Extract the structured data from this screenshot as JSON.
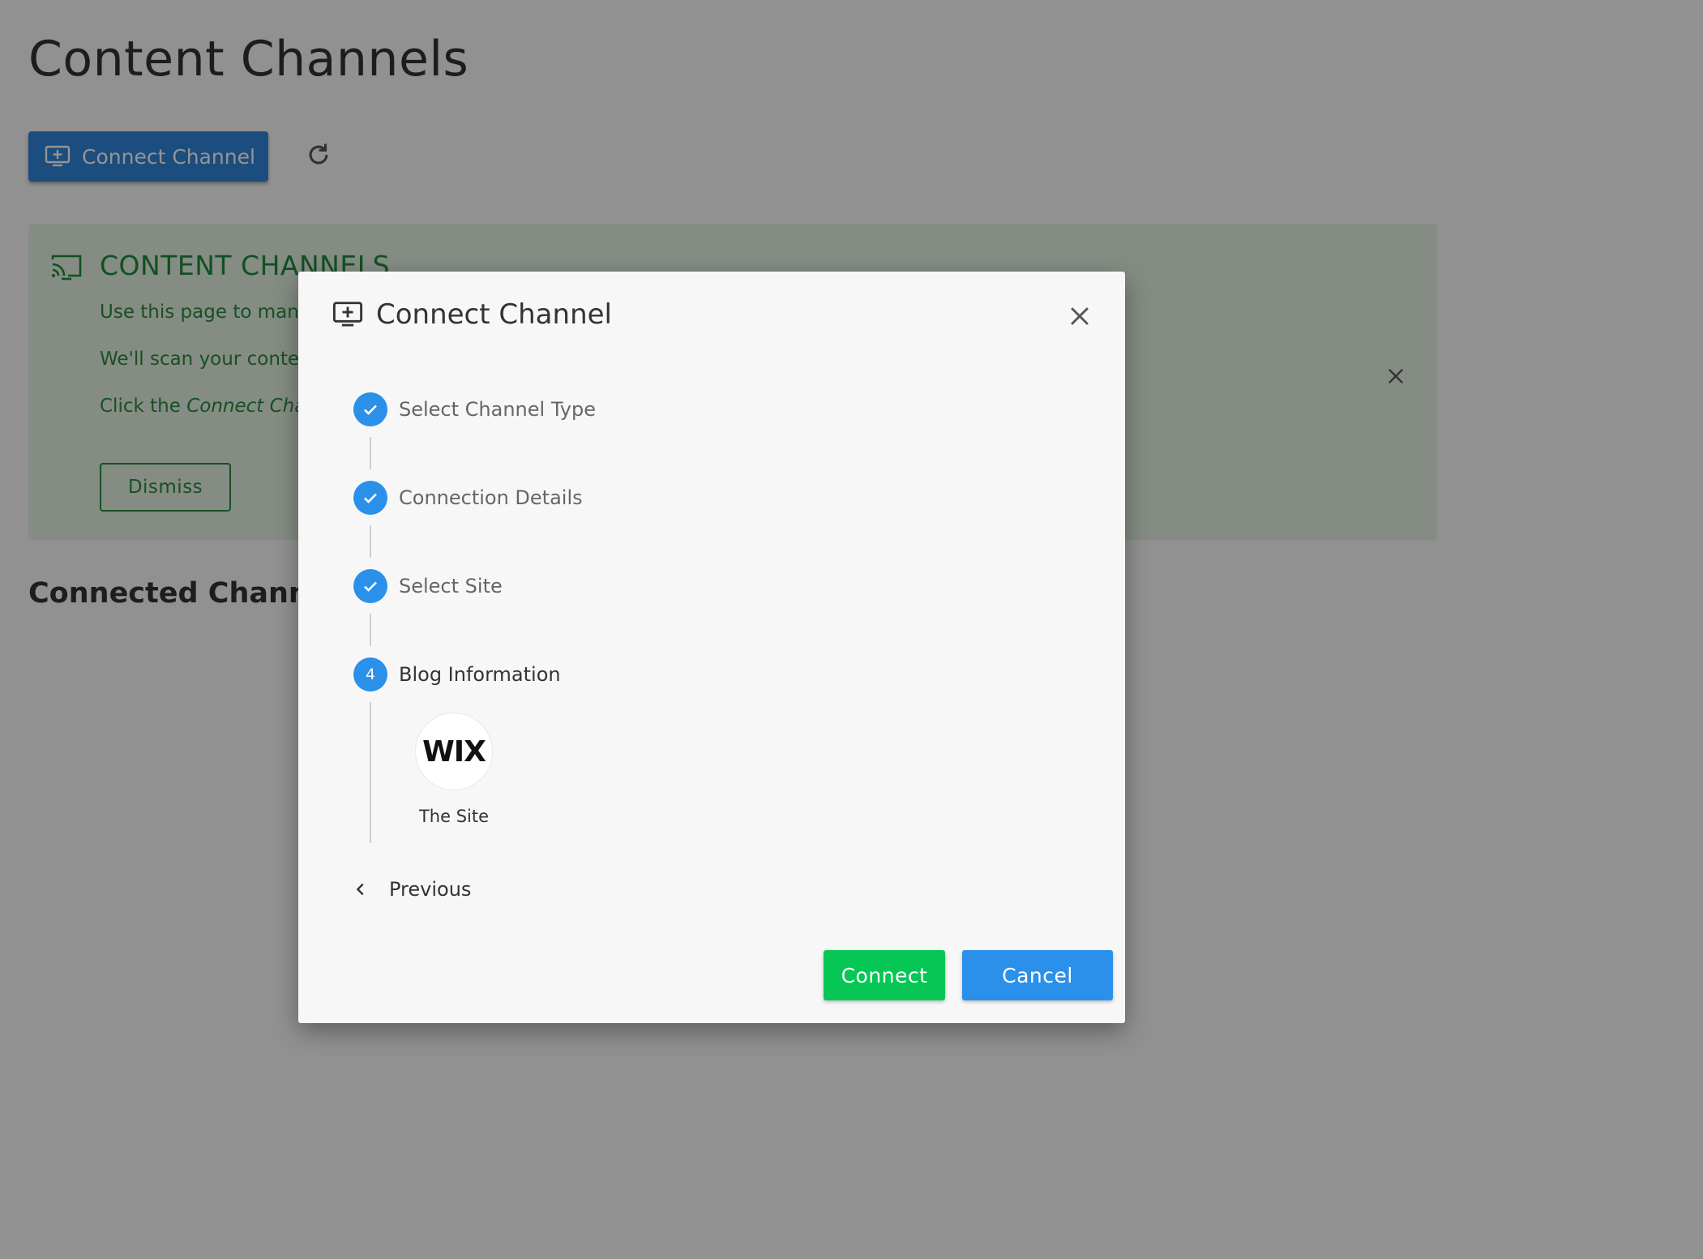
{
  "page": {
    "title": "Content Channels",
    "connect_button_label": "Connect Channel",
    "section_title": "Connected Channels"
  },
  "info_panel": {
    "heading": "CONTENT CHANNELS",
    "line1": "Use this page to mana",
    "line2": "We'll scan your conten",
    "line3_prefix": "Click the ",
    "line3_em": "Connect Chan",
    "dismiss_label": "Dismiss",
    "accent_color": "#1f8b3a"
  },
  "modal": {
    "title": "Connect Channel",
    "steps": [
      {
        "label": "Select Channel Type",
        "state": "done"
      },
      {
        "label": "Connection Details",
        "state": "done"
      },
      {
        "label": "Select Site",
        "state": "done"
      },
      {
        "label": "Blog Information",
        "state": "active",
        "number": "4"
      }
    ],
    "site": {
      "logo_text": "WIX",
      "name": "The Site"
    },
    "previous_label": "Previous",
    "connect_label": "Connect",
    "cancel_label": "Cancel"
  },
  "colors": {
    "primary": "#2b90ea",
    "success": "#06c755"
  },
  "icons": {
    "connect_button": "monitor-plus-icon",
    "refresh": "refresh-icon",
    "info": "cast-icon",
    "close": "close-icon",
    "step_done": "check-icon",
    "previous": "chevron-left-icon"
  }
}
